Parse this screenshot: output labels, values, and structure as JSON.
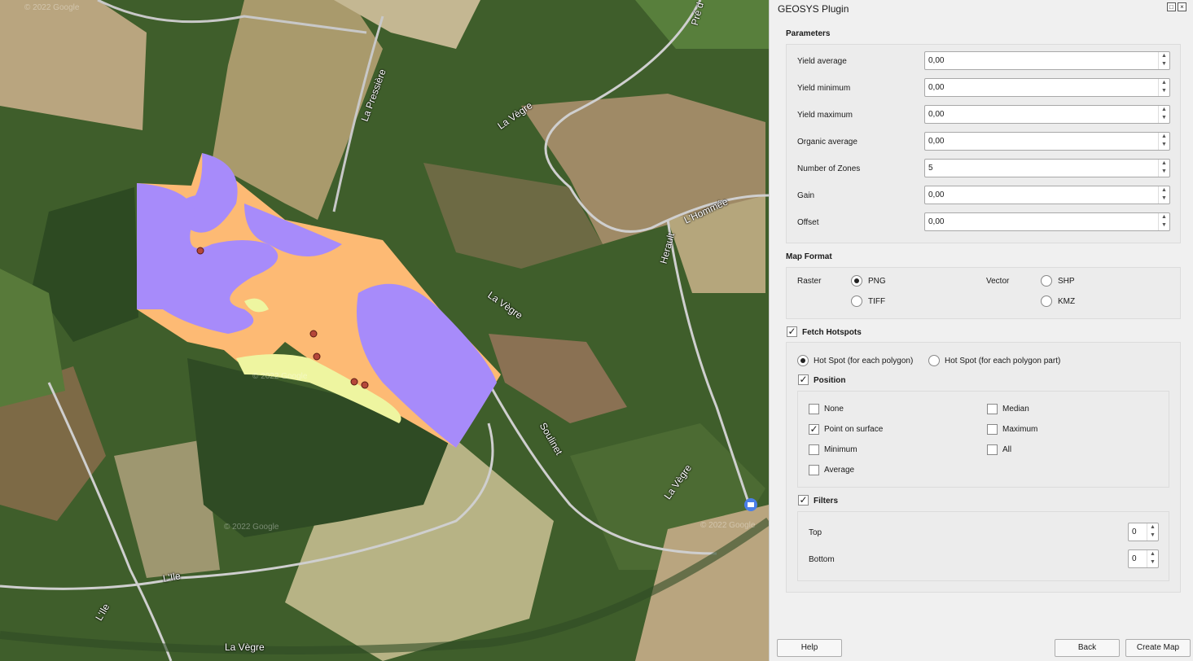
{
  "map": {
    "road_labels": [
      "La Pressière",
      "La Vègre",
      "La Vègre",
      "L'Hommée",
      "Herault",
      "Soulinet",
      "La Vègre",
      "L'Ile",
      "L'Ile",
      "La Vègre",
      "Pré d"
    ],
    "watermarks": [
      "© 2022 Google",
      "© 2022 Google",
      "© 2022 Google",
      "© 2022 Google"
    ],
    "colors": {
      "zone_purple": "#a78bfa",
      "zone_orange": "#fdba74",
      "zone_yellow": "#eef5a0",
      "hotspot": "#b5473a"
    }
  },
  "panel": {
    "title": "GEOSYS Plugin",
    "parameters": {
      "heading": "Parameters",
      "rows": [
        {
          "label": "Yield average",
          "value": "0,00"
        },
        {
          "label": "Yield minimum",
          "value": "0,00"
        },
        {
          "label": "Yield maximum",
          "value": "0,00"
        },
        {
          "label": "Organic average",
          "value": "0,00"
        },
        {
          "label": "Number of Zones",
          "value": "5"
        },
        {
          "label": "Gain",
          "value": "0,00"
        },
        {
          "label": "Offset",
          "value": "0,00"
        }
      ]
    },
    "map_format": {
      "heading": "Map Format",
      "raster_label": "Raster",
      "vector_label": "Vector",
      "png": "PNG",
      "tiff": "TIFF",
      "shp": "SHP",
      "kmz": "KMZ"
    },
    "hotspots": {
      "label": "Fetch Hotspots",
      "per_polygon": "Hot Spot (for each polygon)",
      "per_part": "Hot Spot (for each polygon part)",
      "position_label": "Position",
      "none": "None",
      "point_on_surface": "Point on surface",
      "minimum": "Minimum",
      "average": "Average",
      "median": "Median",
      "maximum": "Maximum",
      "all": "All",
      "filters_label": "Filters",
      "top_label": "Top",
      "top_value": "0",
      "bottom_label": "Bottom",
      "bottom_value": "0"
    },
    "buttons": {
      "help": "Help",
      "back": "Back",
      "create": "Create Map"
    }
  }
}
